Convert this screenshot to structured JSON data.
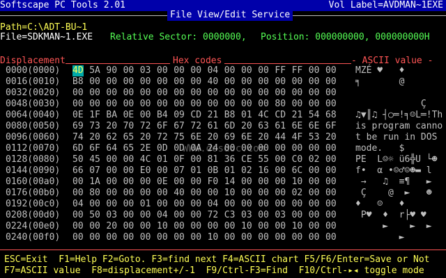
{
  "header": {
    "app": "Softscape PC Tools 2.01",
    "vol": "Vol Label=AVDMAN~1EXE",
    "title": "File View/Edit Service"
  },
  "path": "Path=C:\\ADT-BU~1",
  "file": "File=SDKMAN~1.EXE",
  "relative": "Relative Sector: 0000000,",
  "position": "Position: 000000000, 000000000H",
  "columns": {
    "displacement": "Displacement",
    "hex": "Hex codes",
    "ascii": "- ASCII value -"
  },
  "rows": [
    {
      "disp": "0000(0000)",
      "hex": [
        "4D",
        "5A",
        "90",
        "00",
        "03",
        "00",
        "00",
        "00",
        "04",
        "00",
        "00",
        "00",
        "FF",
        "FF",
        "00",
        "00"
      ],
      "ascii": "MZÉ ♥   ♦       "
    },
    {
      "disp": "0016(0010)",
      "hex": [
        "B8",
        "00",
        "00",
        "00",
        "00",
        "00",
        "00",
        "00",
        "40",
        "00",
        "00",
        "00",
        "00",
        "00",
        "00",
        "00"
      ],
      "ascii": "╕       @       "
    },
    {
      "disp": "0032(0020)",
      "hex": [
        "00",
        "00",
        "00",
        "00",
        "00",
        "00",
        "00",
        "00",
        "00",
        "00",
        "00",
        "00",
        "00",
        "00",
        "00",
        "00"
      ],
      "ascii": "                "
    },
    {
      "disp": "0048(0030)",
      "hex": [
        "00",
        "00",
        "00",
        "00",
        "00",
        "00",
        "00",
        "00",
        "00",
        "00",
        "00",
        "00",
        "80",
        "00",
        "00",
        "00"
      ],
      "ascii": "            Ç   "
    },
    {
      "disp": "0064(0040)",
      "hex": [
        "0E",
        "1F",
        "BA",
        "0E",
        "00",
        "B4",
        "09",
        "CD",
        "21",
        "B8",
        "01",
        "4C",
        "CD",
        "21",
        "54",
        "68"
      ],
      "ascii": "♫▼║♫ ┤○═!╕☺L═!Th"
    },
    {
      "disp": "0080(0050)",
      "hex": [
        "69",
        "73",
        "20",
        "70",
        "72",
        "6F",
        "67",
        "72",
        "61",
        "6D",
        "20",
        "63",
        "61",
        "6E",
        "6E",
        "6F"
      ],
      "ascii": "is program canno"
    },
    {
      "disp": "0096(0060)",
      "hex": [
        "74",
        "20",
        "62",
        "65",
        "20",
        "72",
        "75",
        "6E",
        "20",
        "69",
        "6E",
        "20",
        "44",
        "4F",
        "53",
        "20"
      ],
      "ascii": "t be run in DOS "
    },
    {
      "disp": "0112(0070)",
      "hex": [
        "6D",
        "6F",
        "64",
        "65",
        "2E",
        "0D",
        "0D",
        "0A",
        "24",
        "00",
        "00",
        "00",
        "00",
        "00",
        "00",
        "00"
      ],
      "ascii": "mode.   $       "
    },
    {
      "disp": "0128(0080)",
      "hex": [
        "50",
        "45",
        "00",
        "00",
        "4C",
        "01",
        "0F",
        "00",
        "81",
        "36",
        "CE",
        "55",
        "00",
        "C0",
        "02",
        "00"
      ],
      "ascii": "PE  L☺☼ ü6╬U └☻ "
    },
    {
      "disp": "0144(0090)",
      "hex": [
        "66",
        "07",
        "00",
        "00",
        "E0",
        "00",
        "07",
        "01",
        "0B",
        "01",
        "02",
        "16",
        "00",
        "6C",
        "00",
        "00"
      ],
      "ascii": "f•  α •☺♂☺☻▬ l  "
    },
    {
      "disp": "0160(00a0)",
      "hex": [
        "00",
        "1A",
        "00",
        "00",
        "00",
        "0E",
        "00",
        "00",
        "F0",
        "14",
        "00",
        "00",
        "00",
        "10",
        "00",
        "00"
      ],
      "ascii": " →   ♫  ≡¶   ►  "
    },
    {
      "disp": "0176(00b0)",
      "hex": [
        "00",
        "80",
        "00",
        "00",
        "00",
        "00",
        "40",
        "00",
        "00",
        "10",
        "00",
        "00",
        "00",
        "02",
        "00",
        "00"
      ],
      "ascii": " Ç    @  ►   ☻  "
    },
    {
      "disp": "0192(00c0)",
      "hex": [
        "04",
        "00",
        "00",
        "00",
        "01",
        "00",
        "00",
        "00",
        "04",
        "00",
        "00",
        "00",
        "00",
        "00",
        "00",
        "00"
      ],
      "ascii": "♦   ☺   ♦       "
    },
    {
      "disp": "0208(00d0)",
      "hex": [
        "00",
        "50",
        "03",
        "00",
        "00",
        "04",
        "00",
        "00",
        "72",
        "C3",
        "03",
        "00",
        "03",
        "00",
        "00",
        "00"
      ],
      "ascii": " P♥  ♦  r├♥ ♥   "
    },
    {
      "disp": "0224(00e0)",
      "hex": [
        "00",
        "00",
        "20",
        "00",
        "00",
        "10",
        "00",
        "00",
        "00",
        "00",
        "10",
        "00",
        "00",
        "10",
        "00",
        "00"
      ],
      "ascii": "     ►    ►  ►  "
    },
    {
      "disp": "0240(00f0)",
      "hex": [
        "00",
        "00",
        "00",
        "00",
        "00",
        "00",
        "00",
        "00",
        "10",
        "00",
        "00",
        "00",
        "00",
        "00",
        "00",
        "00"
      ],
      "ascii": "        ►       "
    }
  ],
  "watermark": "WWW.dosdoc.com",
  "footer": {
    "line1": "ESC=Exit  F1=Help F2=Goto. F3=find next F4=ASCII chart F5/F6/Enter=Save or Not",
    "line2": "F7=ASCII value  F8=displacement+/-1  F9/Ctrl-F3=Find  F10/Ctrl-▸◂ toggle mode"
  },
  "colors": {
    "background": "#000000",
    "header_bar": "#0000aa",
    "text": "#c0c0c0",
    "accent_red": "#ff5555",
    "accent_green": "#55ff55",
    "cursor_bg": "#00aaaa",
    "cursor_fg": "#ffff55"
  },
  "cursor": {
    "row": 0,
    "col": 0
  }
}
